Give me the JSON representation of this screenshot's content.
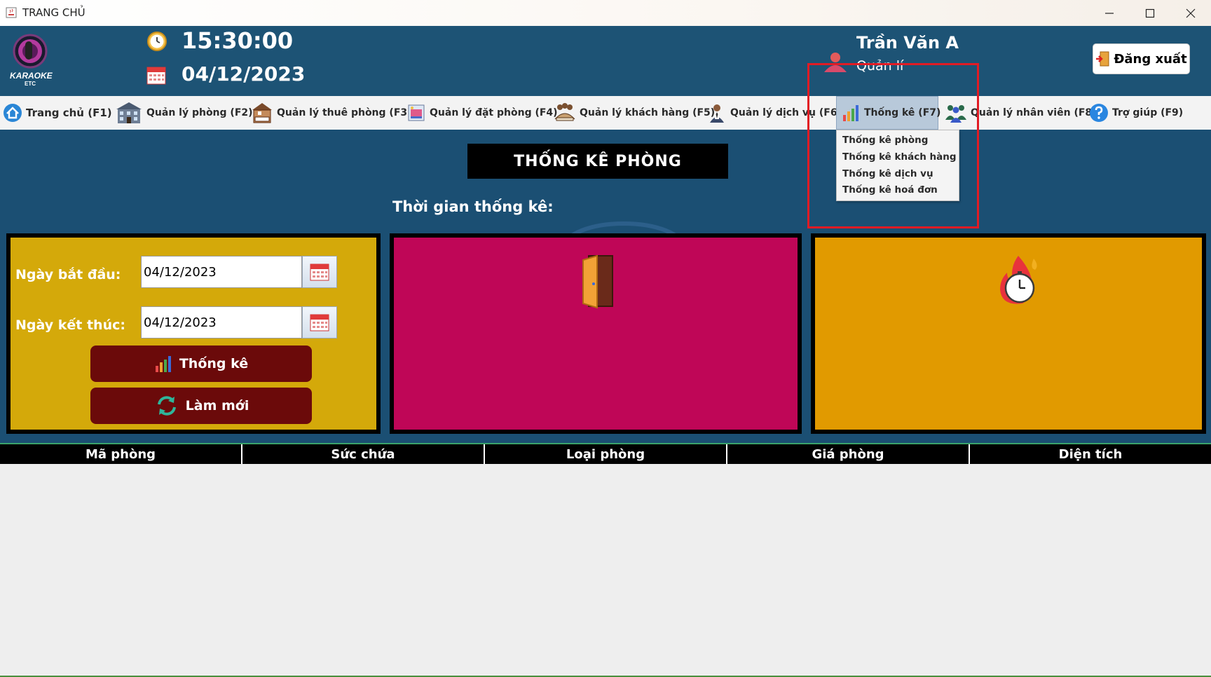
{
  "window": {
    "title": "TRANG CHỦ",
    "controls": [
      "minimize",
      "maximize",
      "close"
    ]
  },
  "header": {
    "logo_text": "KARAOKE",
    "logo_subtext": "ETC",
    "time": "15:30:00",
    "date": "04/12/2023",
    "user_name": "Trần Văn A",
    "user_role": "Quản lí",
    "logout_label": "Đăng xuất"
  },
  "menu": {
    "items": [
      {
        "label": "Trang chủ (F1)",
        "icon": "home-icon"
      },
      {
        "label": "Quản lý phòng (F2)",
        "icon": "building-icon"
      },
      {
        "label": "Quản lý thuê phòng (F3)",
        "icon": "rent-room-icon"
      },
      {
        "label": "Quản lý đặt phòng (F4)",
        "icon": "booking-icon"
      },
      {
        "label": "Quản lý khách hàng (F5)",
        "icon": "customers-icon"
      },
      {
        "label": "Quản lý dịch vụ (F6)",
        "icon": "service-staff-icon"
      },
      {
        "label": "Thống kê (F7)",
        "icon": "bar-chart-icon",
        "active": true
      },
      {
        "label": "Quản lý nhân viên (F8)",
        "icon": "employees-icon"
      },
      {
        "label": "Trợ giúp (F9)",
        "icon": "help-icon"
      }
    ],
    "dropdown": [
      "Thống kê phòng",
      "Thống kê khách hàng",
      "Thống kê dịch vụ",
      "Thống kê hoá đơn"
    ]
  },
  "main": {
    "title": "THỐNG KÊ PHÒNG",
    "period_label": "Thời gian thống kê:",
    "start_label": "Ngày bắt đầu:",
    "start_value": "04/12/2023",
    "end_label": "Ngày kết thúc:",
    "end_value": "04/12/2023",
    "stat_button": "Thống kê",
    "refresh_button": "Làm mới"
  },
  "table": {
    "columns": [
      "Mã phòng",
      "Sức chứa",
      "Loại phòng",
      "Giá phòng",
      "Diện tích"
    ],
    "rows": []
  },
  "colors": {
    "header_bg": "#1d5375",
    "panel_left": "#d4a90a",
    "panel_mid": "#bf0657",
    "panel_right": "#e19a00",
    "button_bg": "#6b0a0a",
    "highlight_box": "#e21b24"
  }
}
